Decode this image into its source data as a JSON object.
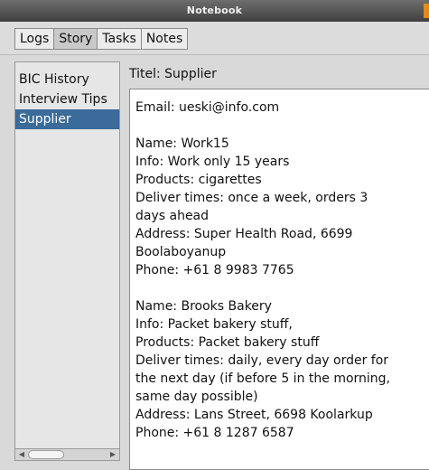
{
  "window": {
    "title": "Notebook"
  },
  "tabs": [
    "Logs",
    "Story",
    "Tasks",
    "Notes"
  ],
  "active_tab": "Story",
  "sidebar": {
    "items": [
      "BIC History",
      "Interview Tips",
      "Supplier"
    ],
    "selected": "Supplier"
  },
  "detail": {
    "title": "Titel: Supplier",
    "lines": [
      "Email: ueski@info.com",
      "",
      "Name: Work15",
      "Info: Work only 15 years",
      "Products: cigarettes",
      "Deliver times: once a week, orders 3",
      "days ahead",
      "Address: Super Health Road, 6699",
      "Boolaboyanup",
      "Phone: +61 8 9983 7765",
      "",
      "Name: Brooks Bakery",
      "Info: Packet bakery stuff,",
      "Products: Packet bakery stuff",
      "Deliver times: daily, every day order for",
      "the next day (if before 5 in the morning,",
      "same day possible)",
      "Address: Lans  Street, 6698 Koolarkup",
      "Phone: +61 8 1287 6587"
    ]
  },
  "colors": {
    "accent": "#e08a1e",
    "selection": "#3b6b9a",
    "titlebar": "#4a4a4a"
  }
}
